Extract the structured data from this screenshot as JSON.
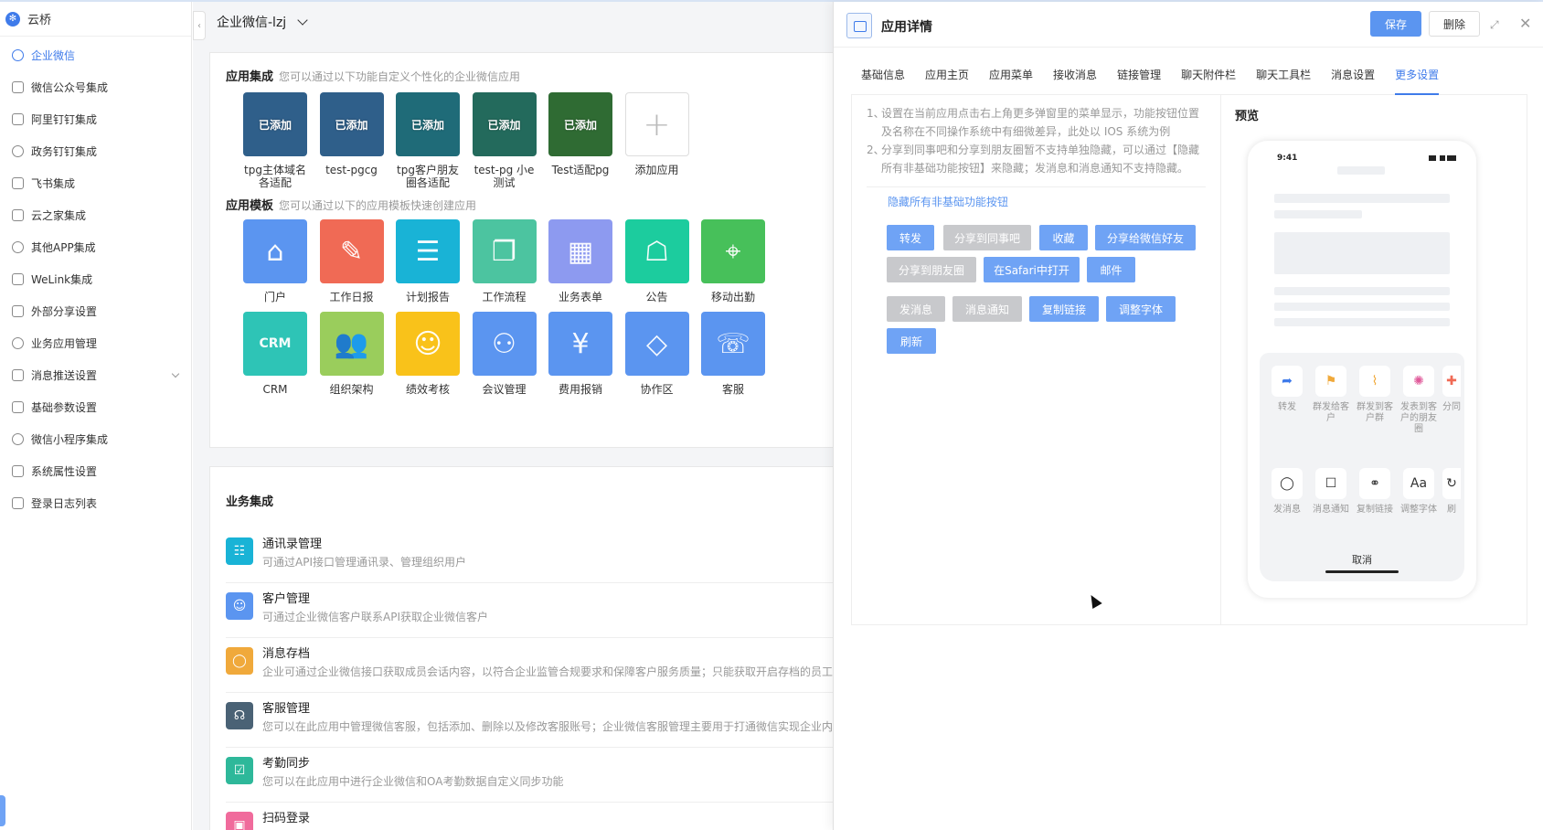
{
  "brand": {
    "name": "云桥"
  },
  "sidebar": {
    "items": [
      {
        "label": "企业微信",
        "active": true
      },
      {
        "label": "微信公众号集成"
      },
      {
        "label": "阿里钉钉集成"
      },
      {
        "label": "政务钉钉集成"
      },
      {
        "label": "飞书集成"
      },
      {
        "label": "云之家集成"
      },
      {
        "label": "其他APP集成"
      },
      {
        "label": "WeLink集成"
      },
      {
        "label": "外部分享设置"
      },
      {
        "label": "业务应用管理"
      },
      {
        "label": "消息推送设置",
        "hasSub": true
      },
      {
        "label": "基础参数设置"
      },
      {
        "label": "微信小程序集成"
      },
      {
        "label": "系统属性设置"
      },
      {
        "label": "登录日志列表"
      }
    ]
  },
  "main": {
    "workspace": "企业微信-lzj",
    "collapse_glyph": "‹",
    "app_integration": {
      "title": "应用集成",
      "hint": "您可以通过以下功能自定义个性化的企业微信应用",
      "apps": [
        {
          "name": "tpg主体域名各适配",
          "badge": "已添加",
          "color": "#2f5f8a"
        },
        {
          "name": "test-pgcg",
          "badge": "已添加",
          "color": "#2f5f8a"
        },
        {
          "name": "tpg客户朋友圈各适配",
          "badge": "已添加",
          "color": "#1f6b78"
        },
        {
          "name": "test-pg 小e测试",
          "badge": "已添加",
          "color": "#236a5c"
        },
        {
          "name": "Test适配pg",
          "badge": "已添加",
          "color": "#2f6b33"
        },
        {
          "name": "添加应用",
          "badge": "",
          "plus": "+"
        }
      ]
    },
    "app_templates": {
      "title": "应用模板",
      "hint": "您可以通过以下的应用模板快速创建应用",
      "rows": [
        [
          {
            "name": "门户",
            "color": "#5b95f0",
            "glyph": "⌂"
          },
          {
            "name": "工作日报",
            "color": "#f06a55",
            "glyph": "✎"
          },
          {
            "name": "计划报告",
            "color": "#19b3d6",
            "glyph": "☰"
          },
          {
            "name": "工作流程",
            "color": "#4cc4a0",
            "glyph": "❐"
          },
          {
            "name": "业务表单",
            "color": "#8d9af0",
            "glyph": "▦"
          },
          {
            "name": "公告",
            "color": "#1ccc9e",
            "glyph": "☖"
          },
          {
            "name": "移动出勤",
            "color": "#47c05a",
            "glyph": "⌖"
          }
        ],
        [
          {
            "name": "CRM",
            "color": "#2ec4b6",
            "glyph": "CRM"
          },
          {
            "name": "组织架构",
            "color": "#9acd5c",
            "glyph": "👥"
          },
          {
            "name": "绩效考核",
            "color": "#f9c21a",
            "glyph": "☺"
          },
          {
            "name": "会议管理",
            "color": "#5b95f0",
            "glyph": "⚇"
          },
          {
            "name": "费用报销",
            "color": "#5b95f0",
            "glyph": "¥"
          },
          {
            "name": "协作区",
            "color": "#5b95f0",
            "glyph": "◇"
          },
          {
            "name": "客服",
            "color": "#5b95f0",
            "glyph": "☏"
          }
        ]
      ]
    },
    "business": {
      "title": "业务集成",
      "items": [
        {
          "title": "通讯录管理",
          "desc": "可通过API接口管理通讯录、管理组织用户",
          "color": "#19b3d6",
          "glyph": "☷"
        },
        {
          "title": "客户管理",
          "desc": "可通过企业微信客户联系API获取企业微信客户",
          "color": "#5b95f0",
          "glyph": "☺"
        },
        {
          "title": "消息存档",
          "desc": "企业可通过企业微信接口获取成员会话内容，以符合企业监管合规要求和保障客户服务质量；只能获取开启存档的员工",
          "color": "#f0a93b",
          "glyph": "◯"
        },
        {
          "title": "客服管理",
          "desc": "您可以在此应用中管理微信客服，包括添加、删除以及修改客服账号；企业微信客服管理主要用于打通微信实现企业内",
          "color": "#4a6275",
          "glyph": "☊"
        },
        {
          "title": "考勤同步",
          "desc": "您可以在此应用中进行企业微信和OA考勤数据自定义同步功能",
          "color": "#2eb89a",
          "glyph": "☑"
        },
        {
          "title": "扫码登录",
          "desc": "",
          "color": "#f06b9c",
          "glyph": "▣"
        }
      ]
    }
  },
  "drawer": {
    "title": "应用详情",
    "save": "保存",
    "delete": "删除",
    "expand_glyph": "⤢",
    "close_glyph": "✕",
    "tabs": [
      {
        "label": "基础信息"
      },
      {
        "label": "应用主页"
      },
      {
        "label": "应用菜单"
      },
      {
        "label": "接收消息"
      },
      {
        "label": "链接管理"
      },
      {
        "label": "聊天附件栏"
      },
      {
        "label": "聊天工具栏"
      },
      {
        "label": "消息设置"
      },
      {
        "label": "更多设置",
        "active": true
      }
    ],
    "notes": [
      "设置在当前应用点击右上角更多弹窗里的菜单显示，功能按钮位置及名称在不同操作系统中有细微差异，此处以 IOS 系统为例",
      "分享到同事吧和分享到朋友圈暂不支持单独隐藏，可以通过【隐藏所有非基础功能按钮】来隐藏；发消息和消息通知不支持隐藏。"
    ],
    "hide_link": "隐藏所有非基础功能按钮",
    "tags": [
      {
        "label": "转发",
        "on": true
      },
      {
        "label": "分享到同事吧",
        "on": false
      },
      {
        "label": "收藏",
        "on": true
      },
      {
        "label": "分享给微信好友",
        "on": true
      },
      {
        "label": "分享到朋友圈",
        "on": false
      },
      {
        "label": "在Safari中打开",
        "on": true
      },
      {
        "label": "邮件",
        "on": true
      },
      {
        "label": "发消息",
        "on": false
      },
      {
        "label": "消息通知",
        "on": false
      },
      {
        "label": "复制链接",
        "on": true
      },
      {
        "label": "调整字体",
        "on": true
      },
      {
        "label": "刷新",
        "on": true
      }
    ],
    "preview": {
      "title": "预览",
      "time": "9:41",
      "row1": [
        {
          "label": "转发",
          "glyph": "➦",
          "color": "#3f7bea"
        },
        {
          "label": "群发给客户",
          "glyph": "⚑",
          "color": "#f0a93b"
        },
        {
          "label": "群发到客户群",
          "glyph": "⌇",
          "color": "#f0a93b"
        },
        {
          "label": "发表到客户的朋友圈",
          "glyph": "✺",
          "color": "#e05a9a"
        },
        {
          "label": "分同",
          "glyph": "✚",
          "color": "#f06a55"
        }
      ],
      "row2": [
        {
          "label": "发消息",
          "glyph": "◯",
          "color": "#333"
        },
        {
          "label": "消息通知",
          "glyph": "☐",
          "color": "#333"
        },
        {
          "label": "复制链接",
          "glyph": "⚭",
          "color": "#333"
        },
        {
          "label": "调整字体",
          "glyph": "Aa",
          "color": "#333"
        },
        {
          "label": "刷",
          "glyph": "↻",
          "color": "#333"
        }
      ],
      "cancel": "取消"
    }
  }
}
